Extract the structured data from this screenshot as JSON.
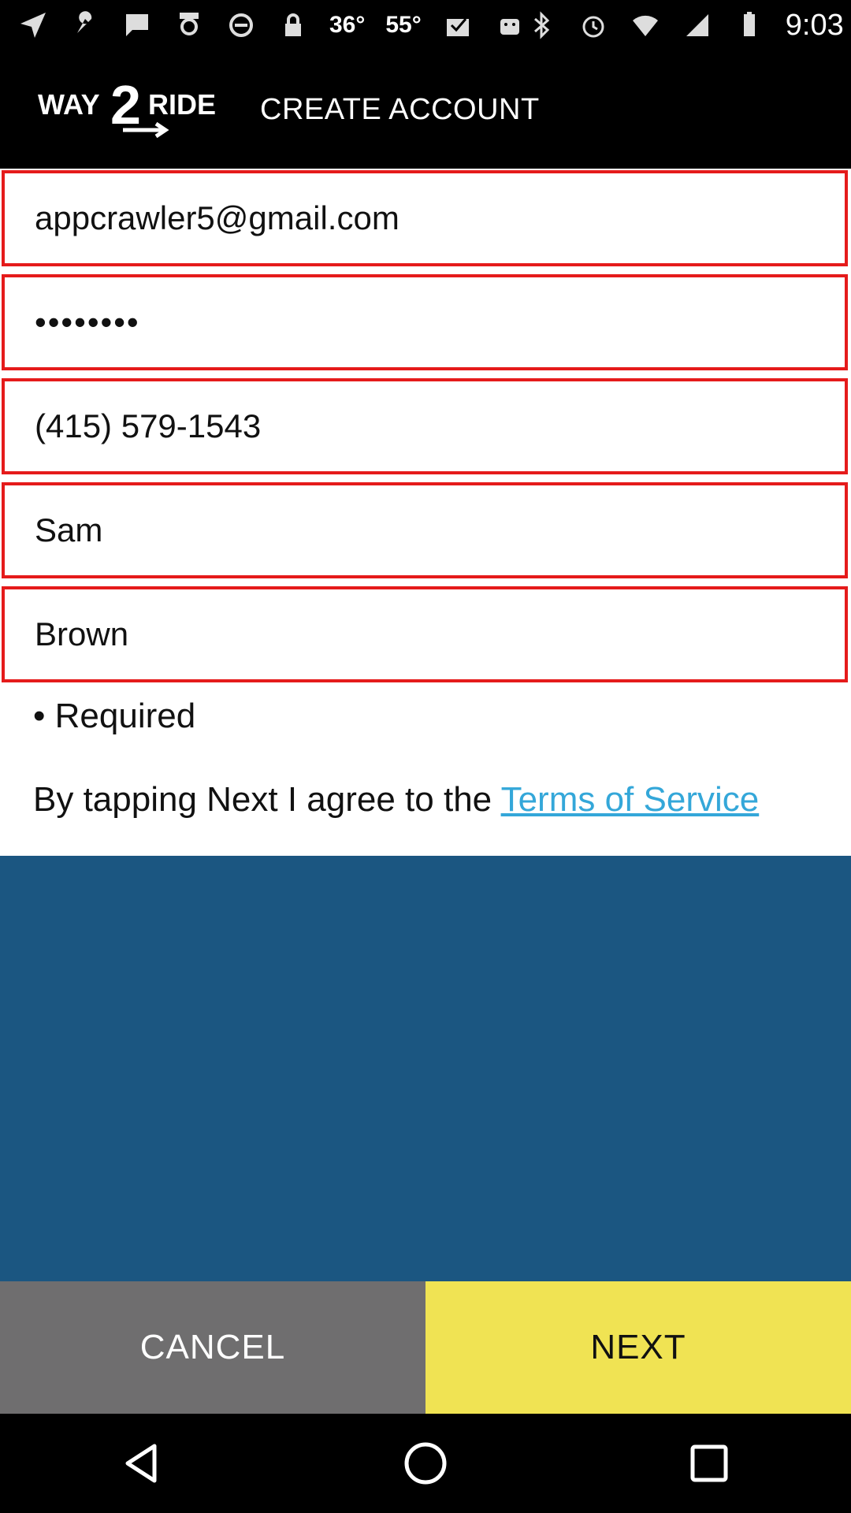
{
  "status_bar": {
    "temp1": "36°",
    "temp2": "55°",
    "time": "9:03",
    "left_icons": [
      "navigation-icon",
      "wrench-icon",
      "chat-icon",
      "fake-gps-icon",
      "block-icon",
      "lock-icon"
    ],
    "right_icons": [
      "bluetooth-icon",
      "alarm-icon",
      "signal-icon",
      "wifi-icon",
      "battery-icon"
    ]
  },
  "header": {
    "logo_text_left": "WAY",
    "logo_text_num": "2",
    "logo_text_right": "RIDE",
    "title": "CREATE ACCOUNT"
  },
  "form": {
    "email": "appcrawler5@gmail.com",
    "password": "••••••••",
    "phone": "(415) 579-1543",
    "first_name": "Sam",
    "last_name": "Brown",
    "required_note": "• Required",
    "terms_prefix": "By tapping Next I agree to the ",
    "terms_link": "Terms of Service"
  },
  "buttons": {
    "cancel": "CANCEL",
    "next": "NEXT"
  },
  "colors": {
    "field_border": "#e51b1b",
    "link": "#34a7d9",
    "blue_area": "#1b5681",
    "cancel_bg": "#6f6e6f",
    "next_bg": "#f0e353"
  }
}
